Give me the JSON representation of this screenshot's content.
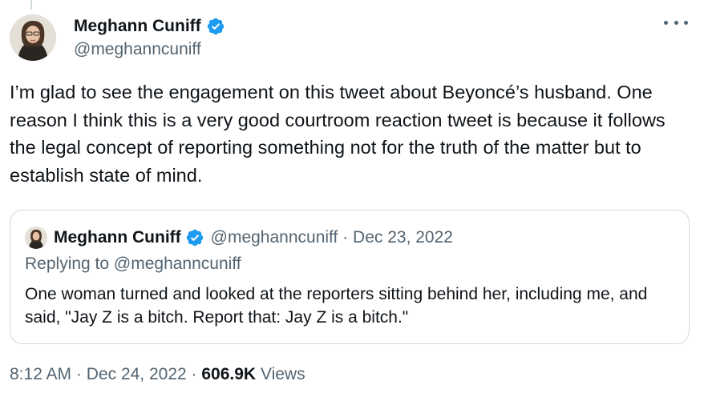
{
  "tweet": {
    "author": {
      "display_name": "Meghann Cuniff",
      "handle": "@meghanncuniff",
      "verified": true
    },
    "more_icon": "more-horizontal-icon",
    "text": "I’m glad to see the engagement on this tweet about Beyoncé’s husband. One reason I think this is a very good courtroom reaction tweet is because it follows the legal concept of reporting something not for the truth of the matter but to establish state of mind.",
    "quoted": {
      "display_name": "Meghann Cuniff",
      "handle": "@meghanncuniff",
      "separator": "·",
      "date": "Dec 23, 2022",
      "replying_prefix": "Replying to ",
      "replying_handle": "@meghanncuniff",
      "text": "One woman turned and looked at the reporters sitting behind her, including me, and said, \"Jay Z is a bitch. Report that: Jay Z is a bitch.\""
    },
    "footer": {
      "time": "8:12 AM",
      "separator1": "·",
      "date": "Dec 24, 2022",
      "separator2": "·",
      "views_count": "606.9K",
      "views_label": "Views"
    }
  },
  "colors": {
    "verified_blue": "#1d9bf0",
    "text_primary": "#0f1419",
    "text_secondary": "#536471",
    "border": "#cfd9de"
  }
}
